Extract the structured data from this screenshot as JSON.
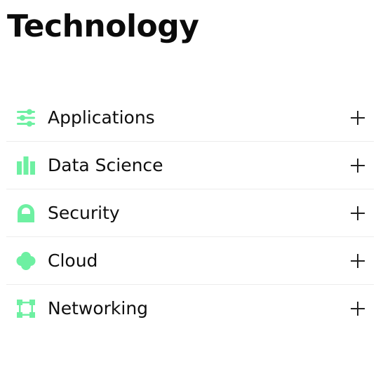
{
  "page": {
    "title": "Technology"
  },
  "accordion": {
    "items": [
      {
        "label": "Applications",
        "icon": "sliders-icon"
      },
      {
        "label": "Data Science",
        "icon": "bar-chart-icon"
      },
      {
        "label": "Security",
        "icon": "lock-icon"
      },
      {
        "label": "Cloud",
        "icon": "cloud-icon"
      },
      {
        "label": "Networking",
        "icon": "network-icon"
      }
    ],
    "expand_symbol": "+"
  },
  "colors": {
    "accent": "#6ef0a2",
    "text": "#111111",
    "divider": "#ececec",
    "background": "#ffffff"
  }
}
